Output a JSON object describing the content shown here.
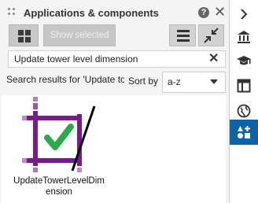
{
  "panel": {
    "title": "Applications & components",
    "help_glyph": "?",
    "close_glyph": "✕"
  },
  "toolbar": {
    "show_selected_label": "Show selected"
  },
  "search": {
    "value": "Update tower level dimension",
    "clear_glyph": "✕"
  },
  "results": {
    "label": "Search results for 'Update to",
    "sort_label": "Sort by",
    "sort_value": "a-z"
  },
  "items": [
    {
      "name": "UpdateTowerLevelDimension",
      "icon": "tower-level-check-icon"
    }
  ],
  "item_label": "UpdateTowerLevelDimension",
  "rail": {
    "icons": [
      "chevron-right-icon",
      "bank-icon",
      "graduation-cap-icon",
      "layout-icon",
      "globe-icon",
      "add-components-icon"
    ],
    "active": "add-components-icon"
  },
  "colors": {
    "accent": "#0e63a6",
    "purple": "#7b1a8c",
    "check_green": "#2aaa4a"
  }
}
